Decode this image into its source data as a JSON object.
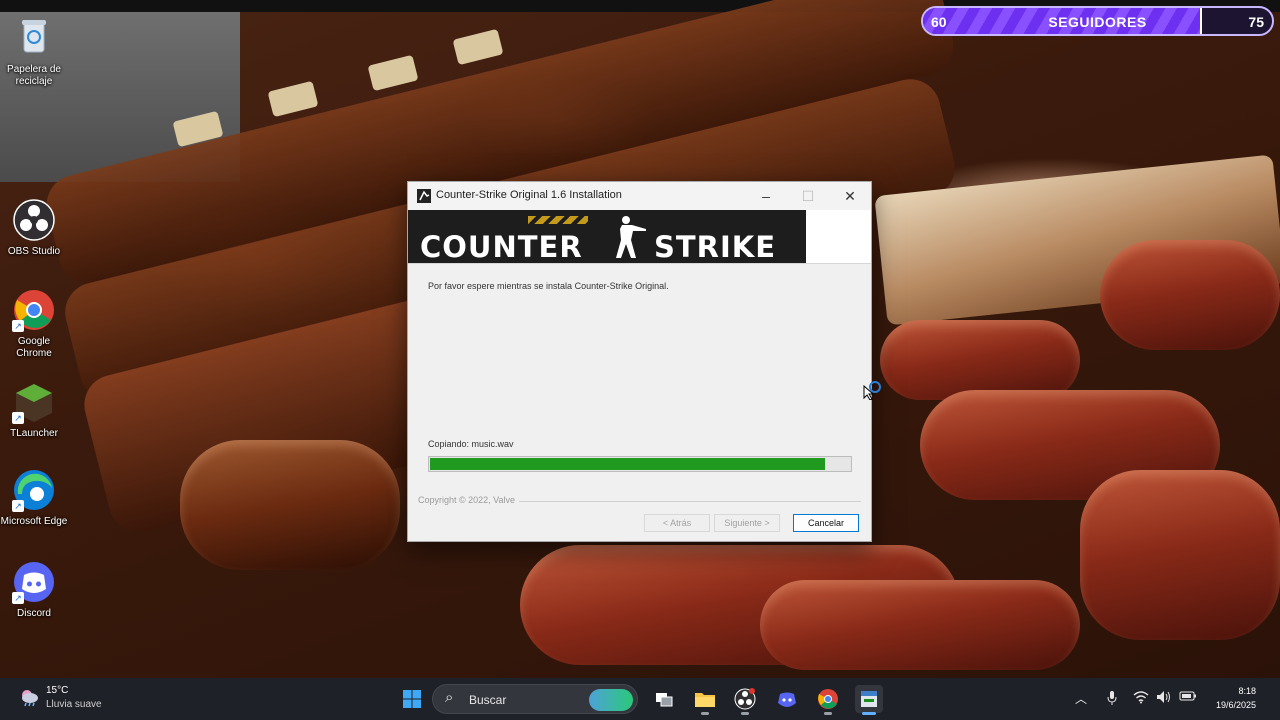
{
  "followers_widget": {
    "current": "60",
    "label": "SEGUIDORES",
    "goal": "75",
    "progress": 0.8,
    "fill_color": "#7a3df5"
  },
  "desktop_icons": [
    {
      "label": "Papelera de reciclaje",
      "icon": "recycle-bin-icon"
    },
    {
      "label": "OBS Studio",
      "icon": "obs-icon"
    },
    {
      "label": "Google Chrome",
      "icon": "chrome-icon"
    },
    {
      "label": "TLauncher",
      "icon": "tlauncher-icon"
    },
    {
      "label": "Microsoft Edge",
      "icon": "edge-icon"
    },
    {
      "label": "Discord",
      "icon": "discord-icon"
    }
  ],
  "installer": {
    "title": "Counter-Strike Original 1.6 Installation",
    "banner_left": "COUNTER",
    "banner_right": "STRIKE",
    "message": "Por favor espere mientras se instala Counter-Strike Original.",
    "copying": "Copiando: music.wav",
    "progress": 0.94,
    "progress_color": "#1f9a1f",
    "copyright": "Copyright © 2022, Valve",
    "buttons": {
      "back": "< Atrás",
      "next": "Siguiente >",
      "cancel": "Cancelar"
    }
  },
  "taskbar": {
    "weather": {
      "temp": "15°C",
      "condition": "Lluvia suave"
    },
    "search_placeholder": "Buscar",
    "clock": {
      "time": "8:18",
      "date": "19/6/2025"
    }
  }
}
